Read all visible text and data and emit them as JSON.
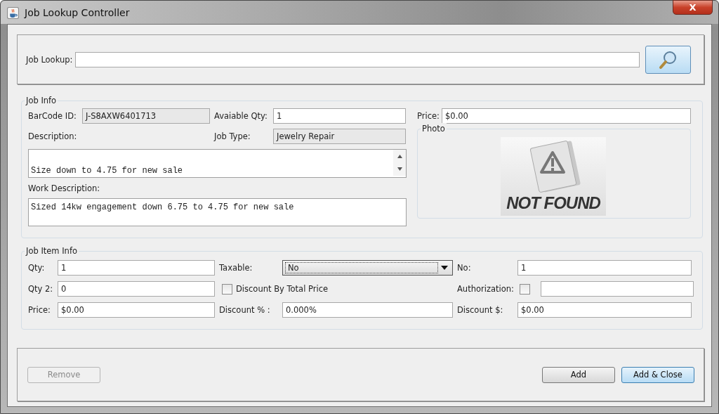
{
  "window": {
    "title": "Job Lookup Controller",
    "close": "X"
  },
  "lookup": {
    "label": "Job Lookup:"
  },
  "job_info": {
    "title": "Job Info",
    "barcode": {
      "label": "BarCode ID:",
      "value": "J-S8AXW6401713",
      "editable": false
    },
    "available_qty": {
      "label": "Avaiable Qty:",
      "value": "1",
      "editable": true
    },
    "price": {
      "label": "Price:",
      "value": "$0.00",
      "editable": true
    },
    "description": {
      "label": "Description:",
      "value": "Size down to 4.75 for new sale"
    },
    "job_type": {
      "label": "Job Type:",
      "value": "Jewelry Repair",
      "editable": false
    },
    "work_description": {
      "label": "Work Description:",
      "value": "Sized 14kw engagement down 6.75 to 4.75 for new sale"
    },
    "photo": {
      "title": "Photo",
      "image_text": "NOT FOUND"
    }
  },
  "job_item_info": {
    "title": "Job Item Info",
    "qty": {
      "label": "Qty:",
      "value": "1"
    },
    "taxable": {
      "label": "Taxable:",
      "value": "No"
    },
    "no": {
      "label": "No:",
      "value": "1"
    },
    "qty2": {
      "label": "Qty 2:",
      "value": "0"
    },
    "discount_by_total": {
      "label": "Discount By Total Price",
      "checked": false
    },
    "authorization": {
      "label": "Authorization:",
      "checked": false
    },
    "price": {
      "label": "Price:",
      "value": "$0.00"
    },
    "discount_pct": {
      "label": "Discount % :",
      "value": "0.000%"
    },
    "discount_amt": {
      "label": "Discount $:",
      "value": "$0.00"
    }
  },
  "buttons": [
    {
      "label": "Remove",
      "disabled": true,
      "focused": false
    },
    {
      "label": "Add",
      "disabled": false,
      "focused": false
    },
    {
      "label": "Add & Close",
      "disabled": false,
      "focused": true
    }
  ]
}
